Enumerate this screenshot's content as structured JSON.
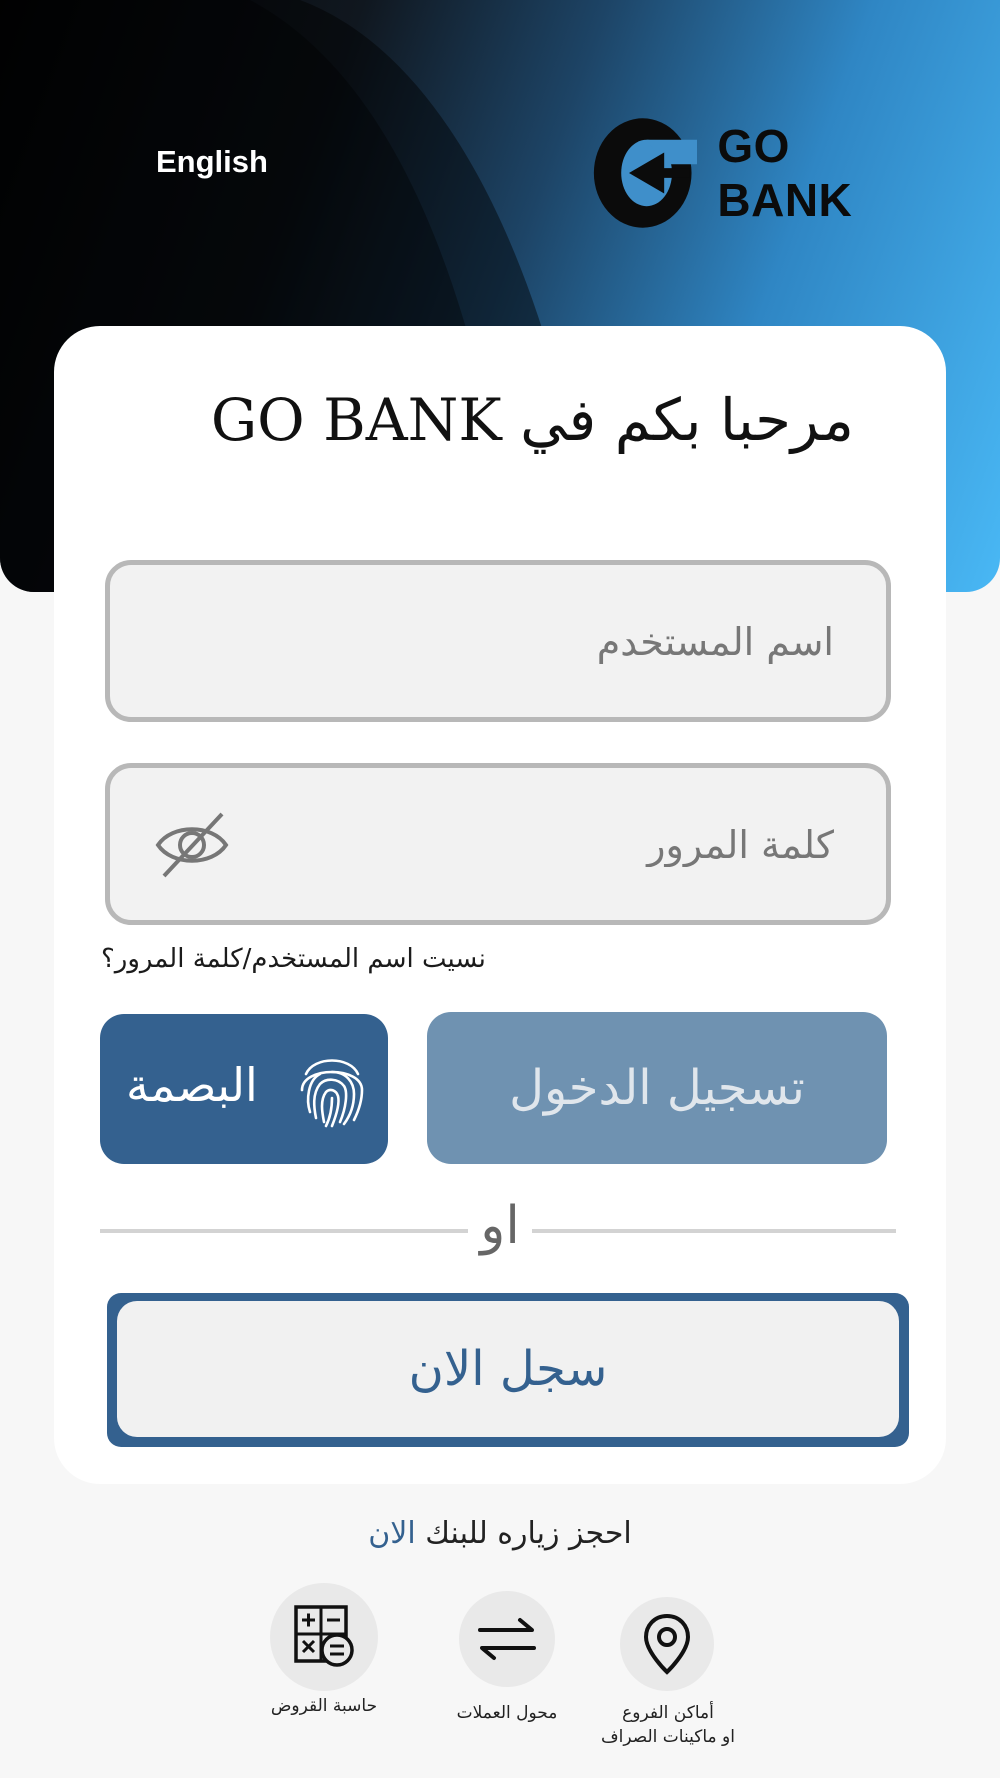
{
  "header": {
    "language_label": "English",
    "brand_name": "GO BANK"
  },
  "card": {
    "welcome_title": "مرحبا بكم في GO BANK",
    "username_placeholder": "اسم المستخدم",
    "password_placeholder": "كلمة المرور",
    "forgot_link": "نسيت اسم المستخدم/كلمة المرور؟",
    "fingerprint_label": "البصمة",
    "login_label": "تسجيل الدخول",
    "or_label": "او",
    "register_label": "سجل الان"
  },
  "footer": {
    "visit_text": "احجز زياره للبنك",
    "visit_link": "الان",
    "services": [
      {
        "label": "أماكن الفروع\nاو ماكينات الصراف",
        "icon": "location-pin-icon"
      },
      {
        "label": "محول العملات",
        "icon": "exchange-arrows-icon"
      },
      {
        "label": "حاسبة القروض",
        "icon": "calculator-icon"
      }
    ]
  },
  "colors": {
    "brand_blue": "#34618f",
    "login_disabled": "#6f92b1",
    "field_border": "#b8b8b8",
    "background": "#f7f7f7"
  }
}
